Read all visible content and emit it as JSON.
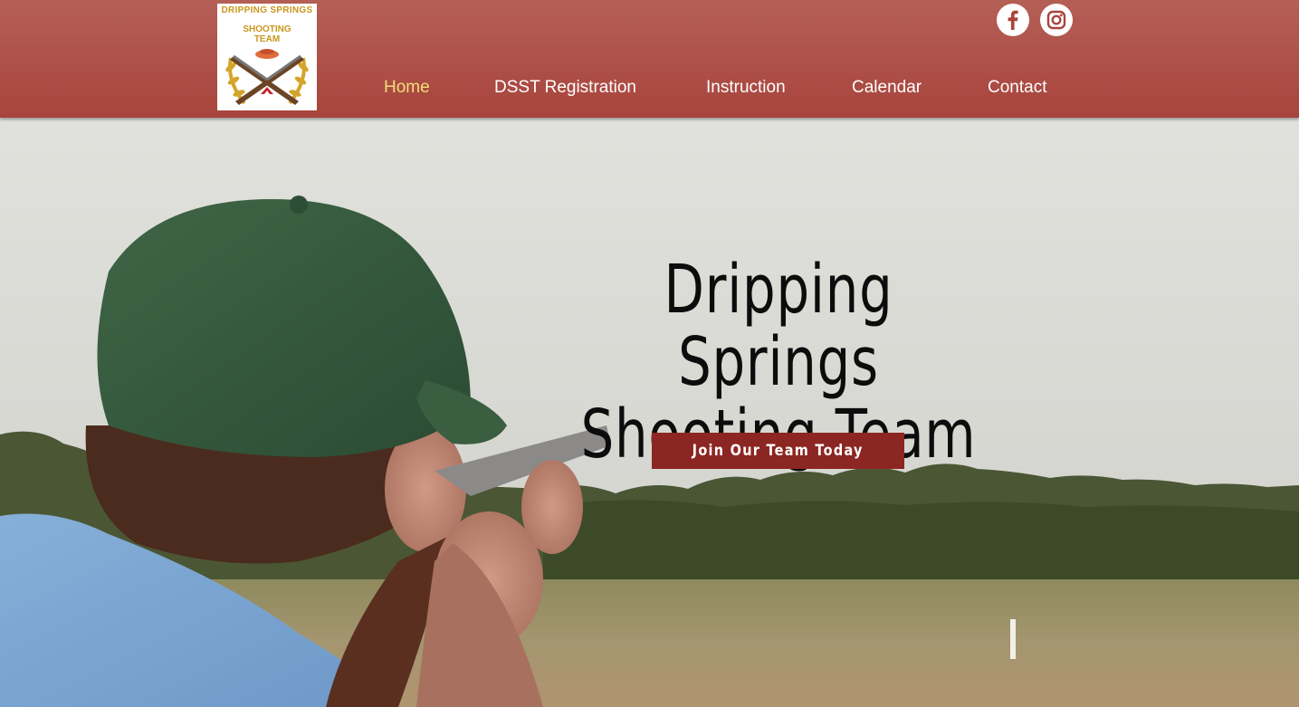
{
  "header": {
    "logo": {
      "line1": "DRIPPING SPRINGS",
      "line2": "SHOOTING",
      "line3": "TEAM"
    },
    "nav": [
      {
        "label": "Home",
        "active": true
      },
      {
        "label": "DSST Registration",
        "active": false
      },
      {
        "label": "Instruction",
        "active": false
      },
      {
        "label": "Calendar",
        "active": false
      },
      {
        "label": "Contact",
        "active": false
      }
    ],
    "social": [
      {
        "icon": "facebook-icon"
      },
      {
        "icon": "instagram-icon"
      }
    ]
  },
  "accessibility": {
    "icon": "accessibility-icon"
  },
  "hero": {
    "title_line1": "Dripping Springs",
    "title_line2": "Shooting Team",
    "cta_label": "Join Our Team Today"
  },
  "colors": {
    "header": "#a8443c",
    "nav_active": "#f3dd7a",
    "nav_text": "#ffffff",
    "cta_background": "#8c2622",
    "accessibility_badge": "#15396b"
  }
}
